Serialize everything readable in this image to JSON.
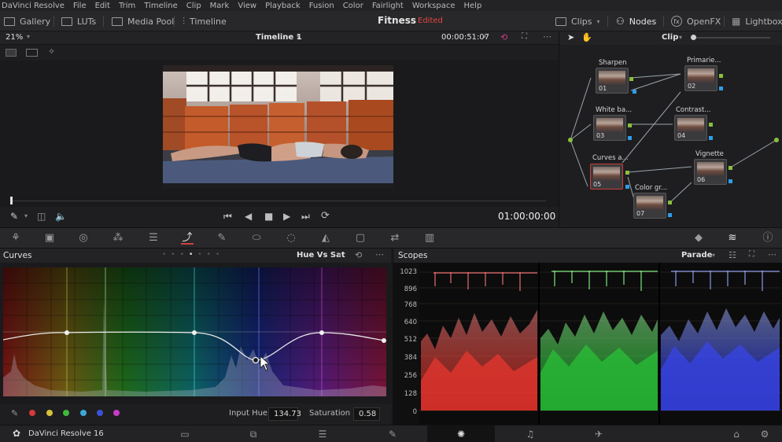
{
  "menu": [
    "DaVinci Resolve",
    "File",
    "Edit",
    "Trim",
    "Timeline",
    "Clip",
    "Mark",
    "View",
    "Playback",
    "Fusion",
    "Color",
    "Fairlight",
    "Workspace",
    "Help"
  ],
  "toolbar": {
    "gallery": "Gallery",
    "luts": "LUTs",
    "media_pool": "Media Pool",
    "timeline": "Timeline",
    "project_title": "Fitness",
    "project_status": "Edited",
    "clips": "Clips",
    "nodes": "Nodes",
    "openfx": "OpenFX",
    "lightbox": "Lightbox"
  },
  "viewer": {
    "zoom": "21%",
    "timeline_name": "Timeline 1",
    "source_timecode": "00:00:51:07",
    "record_timecode": "01:00:00:00"
  },
  "node_editor": {
    "mode": "Clip",
    "nodes": [
      {
        "label": "Sharpen",
        "num": "01"
      },
      {
        "label": "Primarie...",
        "num": "02"
      },
      {
        "label": "White ba...",
        "num": "03"
      },
      {
        "label": "Contrast...",
        "num": "04"
      },
      {
        "label": "Curves a...",
        "num": "05"
      },
      {
        "label": "Vignette",
        "num": "06"
      },
      {
        "label": "Color gr...",
        "num": "07"
      }
    ]
  },
  "curves": {
    "title": "Curves",
    "mode": "Hue Vs Sat",
    "input_hue_label": "Input Hue",
    "input_hue_value": "134.73",
    "saturation_label": "Saturation",
    "saturation_value": "0.58"
  },
  "scopes": {
    "title": "Scopes",
    "mode": "Parade",
    "y_labels": [
      "1023",
      "896",
      "768",
      "640",
      "512",
      "384",
      "256",
      "128",
      "0"
    ]
  },
  "pagebar": {
    "app_name": "DaVinci Resolve 16"
  },
  "colors": {
    "accent_red": "#e0463f",
    "node_green": "#8bbf3c",
    "node_blue": "#2f9ee8"
  }
}
